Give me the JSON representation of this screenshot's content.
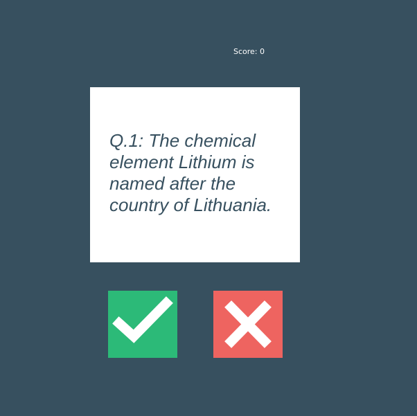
{
  "score": {
    "label": "Score: 0"
  },
  "question": {
    "text": "Q.1: The chemical element Lithium is named after the country of Lithuania."
  },
  "answers": {
    "true_icon": "checkmark-icon",
    "false_icon": "cross-icon"
  },
  "colors": {
    "background": "#37505f",
    "card": "#ffffff",
    "question_text": "#37505f",
    "true_button": "#2cba78",
    "false_button": "#ee6460",
    "icon": "#ffffff"
  }
}
